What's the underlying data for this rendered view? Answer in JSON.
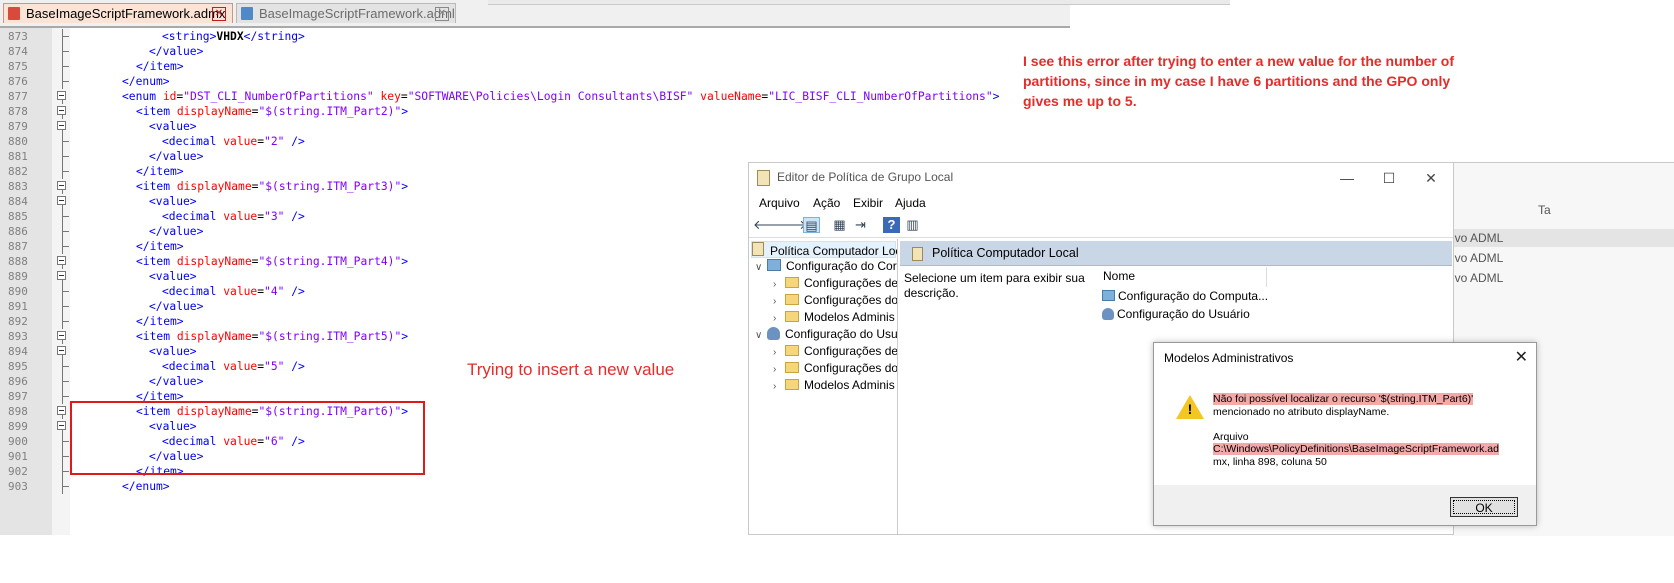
{
  "editor": {
    "tabs": [
      {
        "label": "BaseImageScriptFramework.admx",
        "active": true
      },
      {
        "label": "BaseImageScriptFramework.adml",
        "active": false
      }
    ],
    "lines": [
      {
        "n": "873",
        "fold": "line",
        "indent": 162,
        "parts": [
          [
            "t",
            "<string>"
          ],
          [
            "b",
            "VHDX"
          ],
          [
            "t",
            "</string>"
          ]
        ]
      },
      {
        "n": "874",
        "fold": "line",
        "indent": 149,
        "parts": [
          [
            "t",
            "</value>"
          ]
        ]
      },
      {
        "n": "875",
        "fold": "line",
        "indent": 136,
        "parts": [
          [
            "t",
            "</item>"
          ]
        ]
      },
      {
        "n": "876",
        "fold": "line",
        "indent": 122,
        "parts": [
          [
            "t",
            "</enum>"
          ]
        ]
      },
      {
        "n": "877",
        "fold": "box",
        "indent": 122,
        "parts": [
          [
            "t",
            "<enum "
          ],
          [
            "a",
            "id"
          ],
          [
            "p",
            "="
          ],
          [
            "v",
            "\"DST_CLI_NumberOfPartitions\""
          ],
          [
            "p",
            " "
          ],
          [
            "a",
            "key"
          ],
          [
            "p",
            "="
          ],
          [
            "v",
            "\"SOFTWARE\\Policies\\Login Consultants\\BISF\""
          ],
          [
            "p",
            " "
          ],
          [
            "a",
            "valueName"
          ],
          [
            "p",
            "="
          ],
          [
            "v",
            "\"LIC_BISF_CLI_NumberOfPartitions\""
          ],
          [
            "t",
            ">"
          ]
        ]
      },
      {
        "n": "878",
        "fold": "box",
        "indent": 136,
        "parts": [
          [
            "t",
            "<item "
          ],
          [
            "a",
            "displayName"
          ],
          [
            "p",
            "="
          ],
          [
            "v",
            "\"$(string.ITM_Part2)\""
          ],
          [
            "t",
            ">"
          ]
        ]
      },
      {
        "n": "879",
        "fold": "box",
        "indent": 149,
        "parts": [
          [
            "t",
            "<value>"
          ]
        ]
      },
      {
        "n": "880",
        "fold": "line",
        "indent": 162,
        "parts": [
          [
            "t",
            "<decimal "
          ],
          [
            "a",
            "value"
          ],
          [
            "p",
            "="
          ],
          [
            "v",
            "\"2\""
          ],
          [
            "t",
            " />"
          ]
        ]
      },
      {
        "n": "881",
        "fold": "line",
        "indent": 149,
        "parts": [
          [
            "t",
            "</value>"
          ]
        ]
      },
      {
        "n": "882",
        "fold": "line",
        "indent": 136,
        "parts": [
          [
            "t",
            "</item>"
          ]
        ]
      },
      {
        "n": "883",
        "fold": "box",
        "indent": 136,
        "parts": [
          [
            "t",
            "<item "
          ],
          [
            "a",
            "displayName"
          ],
          [
            "p",
            "="
          ],
          [
            "v",
            "\"$(string.ITM_Part3)\""
          ],
          [
            "t",
            ">"
          ]
        ]
      },
      {
        "n": "884",
        "fold": "box",
        "indent": 149,
        "parts": [
          [
            "t",
            "<value>"
          ]
        ]
      },
      {
        "n": "885",
        "fold": "line",
        "indent": 162,
        "parts": [
          [
            "t",
            "<decimal "
          ],
          [
            "a",
            "value"
          ],
          [
            "p",
            "="
          ],
          [
            "v",
            "\"3\""
          ],
          [
            "t",
            " />"
          ]
        ]
      },
      {
        "n": "886",
        "fold": "line",
        "indent": 149,
        "parts": [
          [
            "t",
            "</value>"
          ]
        ]
      },
      {
        "n": "887",
        "fold": "line",
        "indent": 136,
        "parts": [
          [
            "t",
            "</item>"
          ]
        ]
      },
      {
        "n": "888",
        "fold": "box",
        "indent": 136,
        "parts": [
          [
            "t",
            "<item "
          ],
          [
            "a",
            "displayName"
          ],
          [
            "p",
            "="
          ],
          [
            "v",
            "\"$(string.ITM_Part4)\""
          ],
          [
            "t",
            ">"
          ]
        ]
      },
      {
        "n": "889",
        "fold": "box",
        "indent": 149,
        "parts": [
          [
            "t",
            "<value>"
          ]
        ]
      },
      {
        "n": "890",
        "fold": "line",
        "indent": 162,
        "parts": [
          [
            "t",
            "<decimal "
          ],
          [
            "a",
            "value"
          ],
          [
            "p",
            "="
          ],
          [
            "v",
            "\"4\""
          ],
          [
            "t",
            " />"
          ]
        ]
      },
      {
        "n": "891",
        "fold": "line",
        "indent": 149,
        "parts": [
          [
            "t",
            "</value>"
          ]
        ]
      },
      {
        "n": "892",
        "fold": "line",
        "indent": 136,
        "parts": [
          [
            "t",
            "</item>"
          ]
        ]
      },
      {
        "n": "893",
        "fold": "box",
        "indent": 136,
        "parts": [
          [
            "t",
            "<item "
          ],
          [
            "a",
            "displayName"
          ],
          [
            "p",
            "="
          ],
          [
            "v",
            "\"$(string.ITM_Part5)\""
          ],
          [
            "t",
            ">"
          ]
        ]
      },
      {
        "n": "894",
        "fold": "box",
        "indent": 149,
        "parts": [
          [
            "t",
            "<value>"
          ]
        ]
      },
      {
        "n": "895",
        "fold": "line",
        "indent": 162,
        "parts": [
          [
            "t",
            "<decimal "
          ],
          [
            "a",
            "value"
          ],
          [
            "p",
            "="
          ],
          [
            "v",
            "\"5\""
          ],
          [
            "t",
            " />"
          ]
        ]
      },
      {
        "n": "896",
        "fold": "line",
        "indent": 149,
        "parts": [
          [
            "t",
            "</value>"
          ]
        ]
      },
      {
        "n": "897",
        "fold": "line",
        "indent": 136,
        "parts": [
          [
            "t",
            "</item>"
          ]
        ]
      },
      {
        "n": "898",
        "fold": "box",
        "indent": 136,
        "parts": [
          [
            "t",
            "<item "
          ],
          [
            "a",
            "displayName"
          ],
          [
            "p",
            "="
          ],
          [
            "v",
            "\"$(string.ITM_Part6)\""
          ],
          [
            "t",
            ">"
          ]
        ]
      },
      {
        "n": "899",
        "fold": "box",
        "indent": 149,
        "parts": [
          [
            "t",
            "<value>"
          ]
        ]
      },
      {
        "n": "900",
        "fold": "line",
        "indent": 162,
        "parts": [
          [
            "t",
            "<decimal "
          ],
          [
            "a",
            "value"
          ],
          [
            "p",
            "="
          ],
          [
            "v",
            "\"6\""
          ],
          [
            "t",
            " />"
          ]
        ]
      },
      {
        "n": "901",
        "fold": "line",
        "indent": 149,
        "parts": [
          [
            "t",
            "</value>"
          ]
        ]
      },
      {
        "n": "902",
        "fold": "line",
        "indent": 136,
        "parts": [
          [
            "t",
            "</item>"
          ]
        ]
      },
      {
        "n": "903",
        "fold": "line",
        "indent": 122,
        "parts": [
          [
            "t",
            "</enum>"
          ]
        ]
      }
    ]
  },
  "annotations": {
    "insert_note": "Trying to insert a new value",
    "error_note": "I see this error after trying to enter a new value for the number of partitions, since in my case I have 6 partitions and the GPO only gives me up to 5."
  },
  "gpedit": {
    "title": "Editor de Política de Grupo Local",
    "menu": [
      "Arquivo",
      "Ação",
      "Exibir",
      "Ajuda"
    ],
    "tree": {
      "root": "Política Computador Loc",
      "computer": "Configuração do Cor",
      "computer_children": [
        "Configurações de",
        "Configurações do",
        "Modelos Adminis"
      ],
      "user": "Configuração do Usu",
      "user_children": [
        "Configurações de",
        "Configurações do",
        "Modelos Adminis"
      ]
    },
    "panel_title": "Política Computador Local",
    "description": "Selecione um item para exibir sua descrição.",
    "column_name": "Nome",
    "items": [
      "Configuração do Computa...",
      "Configuração do Usuário"
    ]
  },
  "back_window": {
    "items": [
      "ivo ADML",
      "ivo ADML",
      "ivo ADML"
    ],
    "header_partial": "Ta"
  },
  "dialog": {
    "title": "Modelos Administrativos",
    "msg_line1": "Não foi possível localizar o recurso '$(string.ITM_Part6)'",
    "msg_line2": "mencionado no atributo displayName.",
    "file_label": "Arquivo",
    "file_path": "C:\\Windows\\PolicyDefinitions\\BaseImageScriptFramework.ad",
    "file_pos": "mx, linha 898, coluna 50",
    "ok_label": "OK"
  }
}
